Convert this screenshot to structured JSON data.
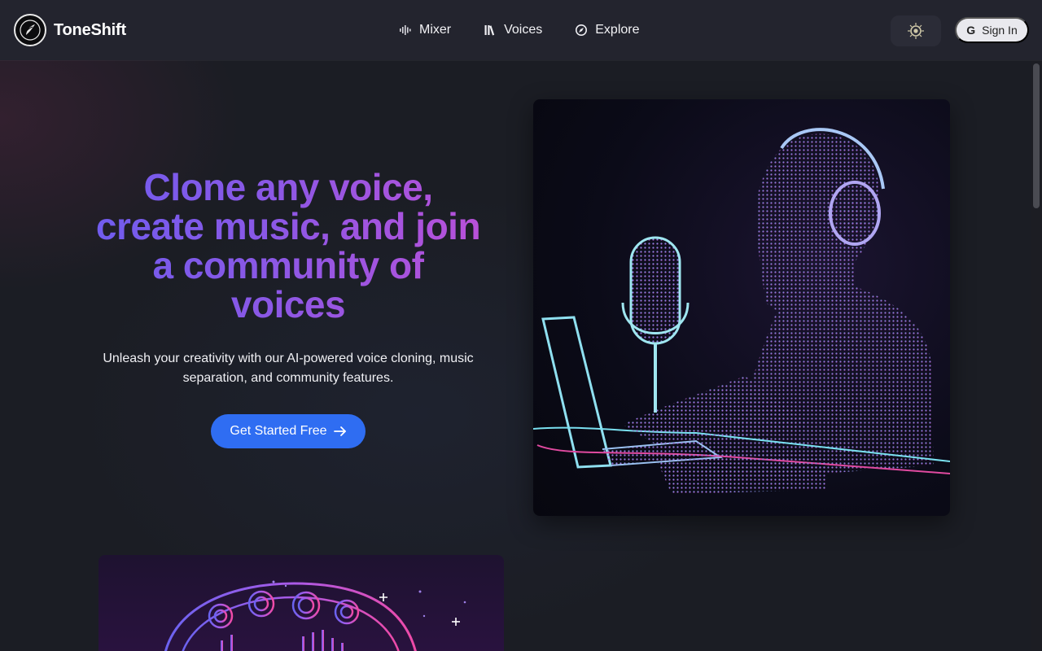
{
  "app": {
    "brand": "ToneShift"
  },
  "nav": {
    "items": [
      {
        "label": "Mixer",
        "icon": "waveform-icon"
      },
      {
        "label": "Voices",
        "icon": "library-icon"
      },
      {
        "label": "Explore",
        "icon": "compass-icon"
      }
    ]
  },
  "header": {
    "theme_toggle_icon": "theme-toggle-icon",
    "signin_label": "Sign In",
    "signin_icon": "G"
  },
  "hero": {
    "title_lines": [
      "Clone any voice,",
      "create music, and join",
      "a community of",
      "voices"
    ],
    "subtitle": "Unleash your creativity with our AI-powered voice cloning, music separation, and community features.",
    "cta_label": "Get Started Free"
  },
  "colors": {
    "accent": "#2f6df2",
    "gradient_start": "#6a5df0",
    "gradient_end": "#c24fd6",
    "header_bg": "#23242e",
    "page_bg": "#1b1d24"
  }
}
